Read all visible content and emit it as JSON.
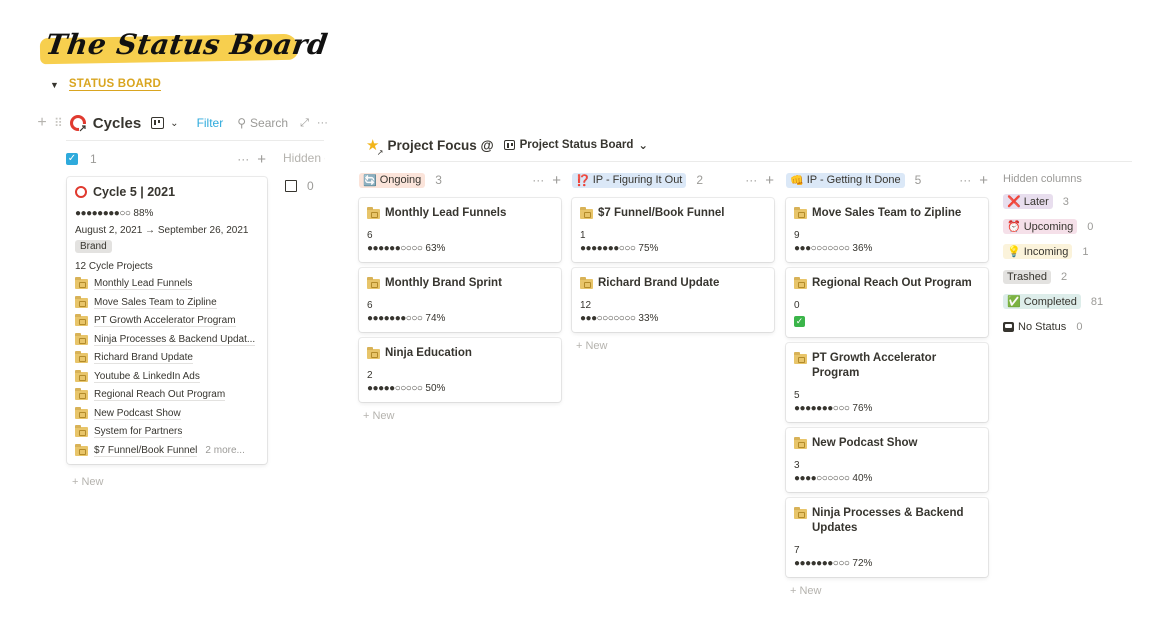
{
  "page": {
    "banner_title": "The Status Board",
    "toggle_label": "STATUS BOARD"
  },
  "cycles": {
    "title": "Cycles",
    "icons": {
      "db_icon": "red-ring-link-icon",
      "view_icon": "board-view-icon"
    },
    "filter_label": "Filter",
    "search_label": "Search",
    "column": {
      "count": "1",
      "checked": true
    },
    "hidden_label": "Hidden columns",
    "unchecked_count": "0",
    "new_label": "New",
    "card": {
      "title": "Cycle 5 | 2021",
      "progress_dots": "●●●●●●●●○○",
      "progress_pct": "88%",
      "progress_value": 0.88,
      "dates": "August 2, 2021 → September 26, 2021",
      "tag": "Brand",
      "projects_label": "12 Cycle Projects",
      "projects": [
        "Monthly Lead Funnels",
        "Move Sales Team to Zipline",
        "PT Growth Accelerator Program",
        "Ninja Processes & Backend Updat...",
        "Richard Brand Update",
        "Youtube & LinkedIn Ads",
        "Regional Reach Out Program",
        "New Podcast Show",
        "System for Partners",
        "$7 Funnel/Book Funnel"
      ],
      "more_label": "2 more..."
    }
  },
  "project_focus": {
    "title": "Project Focus @",
    "view_label": "Project Status Board",
    "new_label": "New",
    "columns": [
      {
        "label": "Ongoing",
        "emoji": "🔄",
        "count": "3",
        "bg": "#fbe4da",
        "fg": "#37352f",
        "cards": [
          {
            "title": "Monthly Lead Funnels",
            "num": "6",
            "dots": "●●●●●●○○○○",
            "pct": "63%"
          },
          {
            "title": "Monthly Brand Sprint",
            "num": "6",
            "dots": "●●●●●●●○○○",
            "pct": "74%"
          },
          {
            "title": "Ninja Education",
            "num": "2",
            "dots": "●●●●●○○○○○",
            "pct": "50%"
          }
        ]
      },
      {
        "label": "IP - Figuring It Out",
        "emoji": "⁉️",
        "count": "2",
        "bg": "#dbe8f7",
        "fg": "#37352f",
        "cards": [
          {
            "title": "$7 Funnel/Book Funnel",
            "num": "1",
            "dots": "●●●●●●●○○○",
            "pct": "75%"
          },
          {
            "title": "Richard Brand Update",
            "num": "12",
            "dots": "●●●○○○○○○○",
            "pct": "33%"
          }
        ]
      },
      {
        "label": "IP - Getting It Done",
        "emoji": "👊",
        "count": "5",
        "bg": "#dbe8f7",
        "fg": "#37352f",
        "cards": [
          {
            "title": "Move Sales Team to Zipline",
            "num": "9",
            "dots": "●●●○○○○○○○",
            "pct": "36%"
          },
          {
            "title": "Regional Reach Out Program",
            "num": "0",
            "dots": "",
            "pct": "",
            "done": true
          },
          {
            "title": "PT Growth Accelerator Program",
            "num": "5",
            "dots": "●●●●●●●○○○",
            "pct": "76%"
          },
          {
            "title": "New Podcast Show",
            "num": "3",
            "dots": "●●●●○○○○○○",
            "pct": "40%"
          },
          {
            "title": "Ninja Processes & Backend Updates",
            "num": "7",
            "dots": "●●●●●●●○○○",
            "pct": "72%"
          }
        ]
      }
    ],
    "hidden_title": "Hidden columns",
    "hidden": [
      {
        "label": "Later",
        "emoji": "❌",
        "count": "3",
        "bg": "#e8deee"
      },
      {
        "label": "Upcoming",
        "emoji": "⏰",
        "count": "0",
        "bg": "#f5e0e9"
      },
      {
        "label": "Incoming",
        "emoji": "💡",
        "count": "1",
        "bg": "#fbf3db"
      },
      {
        "label": "Trashed",
        "emoji": "",
        "count": "2",
        "bg": "#e3e2e0"
      },
      {
        "label": "Completed",
        "emoji": "✅",
        "count": "81",
        "bg": "#ddedea"
      },
      {
        "label": "No Status",
        "emoji": "",
        "count": "0",
        "bg": ""
      }
    ]
  }
}
